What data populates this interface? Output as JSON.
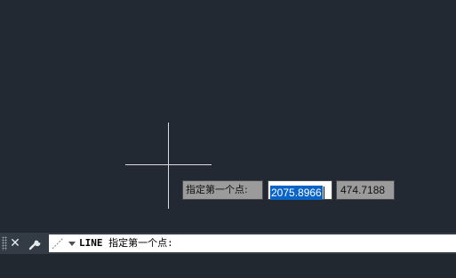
{
  "dynamic_input": {
    "prompt_label": "指定第一个点:",
    "x_value": "2075.8966",
    "y_value": "474.7188"
  },
  "command_line": {
    "close_label": "✕",
    "command_name": "LINE",
    "command_prompt": "指定第一个点:",
    "text_color": "#000000"
  },
  "colors": {
    "canvas_background": "#222932",
    "crosshair": "#d8dde3",
    "selection": "#0a64c8",
    "command_bar": "#333b45"
  }
}
